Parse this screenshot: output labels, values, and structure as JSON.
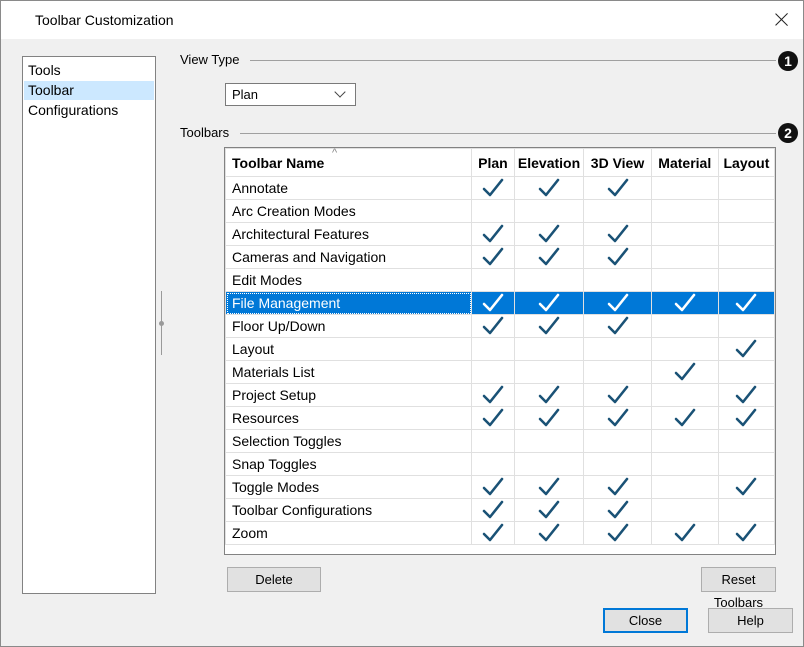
{
  "dialog": {
    "title": "Toolbar Customization"
  },
  "tree": {
    "items": [
      {
        "label": "Tools",
        "selected": false
      },
      {
        "label": "Toolbar",
        "selected": true
      },
      {
        "label": "Configurations",
        "selected": false
      }
    ]
  },
  "view_type": {
    "label": "View Type",
    "selected": "Plan",
    "badge": "1"
  },
  "toolbars": {
    "label": "Toolbars",
    "badge": "2",
    "columns": [
      "Toolbar Name",
      "Plan",
      "Elevation",
      "3D View",
      "Material",
      "Layout"
    ],
    "rows": [
      {
        "name": "Annotate",
        "checks": [
          true,
          true,
          true,
          false,
          false
        ]
      },
      {
        "name": "Arc Creation Modes",
        "checks": [
          false,
          false,
          false,
          false,
          false
        ]
      },
      {
        "name": "Architectural Features",
        "checks": [
          true,
          true,
          true,
          false,
          false
        ]
      },
      {
        "name": "Cameras and Navigation",
        "checks": [
          true,
          true,
          true,
          false,
          false
        ]
      },
      {
        "name": "Edit Modes",
        "checks": [
          false,
          false,
          false,
          false,
          false
        ]
      },
      {
        "name": "File Management",
        "checks": [
          true,
          true,
          true,
          true,
          true
        ],
        "selected": true
      },
      {
        "name": "Floor Up/Down",
        "checks": [
          true,
          true,
          true,
          false,
          false
        ]
      },
      {
        "name": "Layout",
        "checks": [
          false,
          false,
          false,
          false,
          true
        ]
      },
      {
        "name": "Materials List",
        "checks": [
          false,
          false,
          false,
          true,
          false
        ]
      },
      {
        "name": "Project Setup",
        "checks": [
          true,
          true,
          true,
          false,
          true
        ]
      },
      {
        "name": "Resources",
        "checks": [
          true,
          true,
          true,
          true,
          true
        ]
      },
      {
        "name": "Selection Toggles",
        "checks": [
          false,
          false,
          false,
          false,
          false
        ]
      },
      {
        "name": "Snap Toggles",
        "checks": [
          false,
          false,
          false,
          false,
          false
        ]
      },
      {
        "name": "Toggle Modes",
        "checks": [
          true,
          true,
          true,
          false,
          true
        ]
      },
      {
        "name": "Toolbar Configurations",
        "checks": [
          true,
          true,
          true,
          false,
          false
        ]
      },
      {
        "name": "Zoom",
        "checks": [
          true,
          true,
          true,
          true,
          true
        ]
      }
    ]
  },
  "buttons": {
    "delete": "Delete",
    "reset": "Reset Toolbars",
    "close": "Close",
    "help": "Help"
  },
  "colors": {
    "check": "#1a5276",
    "check_selected": "#ffffff",
    "selection": "#0078d7",
    "tree_selection": "#cce8ff"
  },
  "icons": {
    "close": "close-icon",
    "check": "check-icon",
    "dropdown": "chevron-down-icon",
    "sort": "sort-ascending-icon"
  }
}
